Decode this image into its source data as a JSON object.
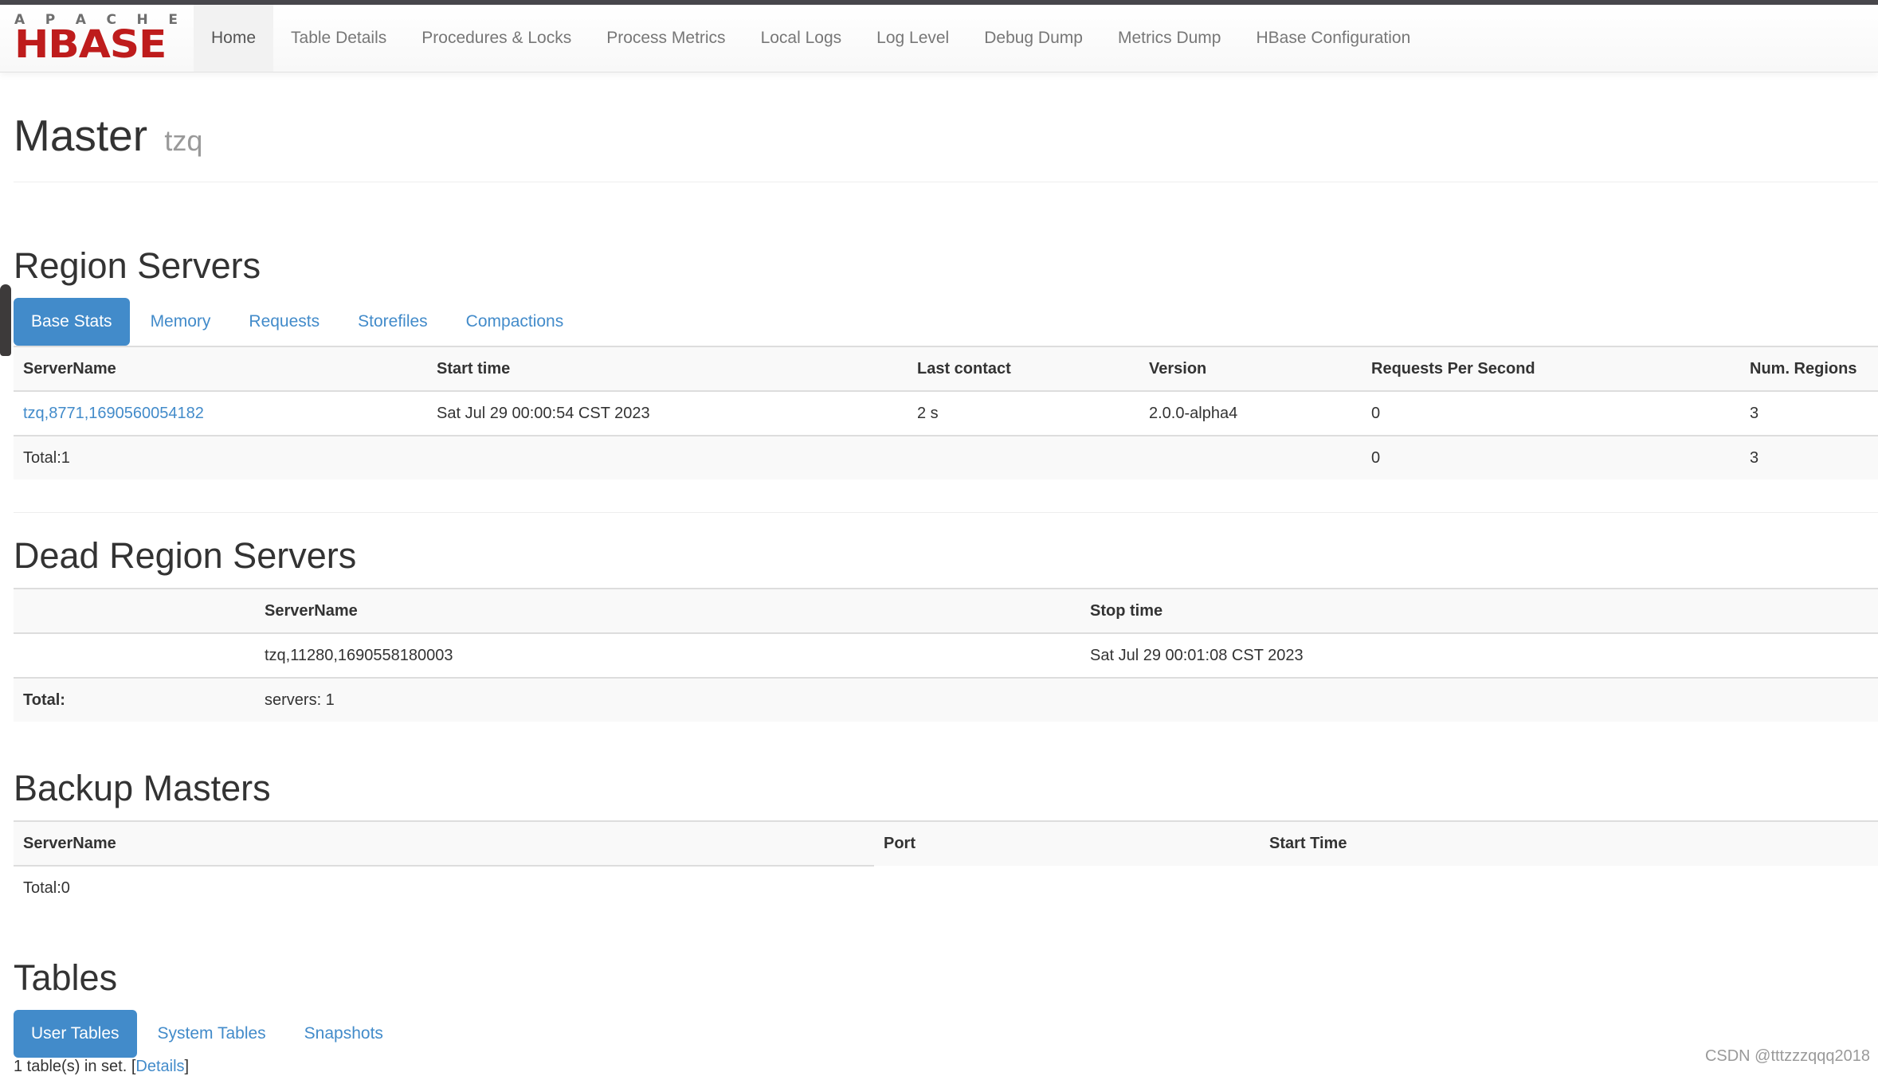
{
  "brand": {
    "top": "APACHE",
    "name": "HBASE"
  },
  "nav": {
    "items": [
      {
        "label": "Home",
        "active": true
      },
      {
        "label": "Table Details"
      },
      {
        "label": "Procedures & Locks"
      },
      {
        "label": "Process Metrics"
      },
      {
        "label": "Local Logs"
      },
      {
        "label": "Log Level"
      },
      {
        "label": "Debug Dump"
      },
      {
        "label": "Metrics Dump"
      },
      {
        "label": "HBase Configuration"
      }
    ]
  },
  "header": {
    "title": "Master",
    "subtitle": "tzq"
  },
  "region_servers": {
    "title": "Region Servers",
    "tabs": [
      "Base Stats",
      "Memory",
      "Requests",
      "Storefiles",
      "Compactions"
    ],
    "active_tab": "Base Stats",
    "columns": [
      "ServerName",
      "Start time",
      "Last contact",
      "Version",
      "Requests Per Second",
      "Num. Regions"
    ],
    "rows": [
      {
        "server_name": "tzq,8771,1690560054182",
        "start_time": "Sat Jul 29 00:00:54 CST 2023",
        "last_contact": "2 s",
        "version": "2.0.0-alpha4",
        "requests_per_second": "0",
        "num_regions": "3"
      }
    ],
    "total": {
      "label": "Total:1",
      "requests_per_second": "0",
      "num_regions": "3"
    }
  },
  "dead_region_servers": {
    "title": "Dead Region Servers",
    "columns": [
      "",
      "ServerName",
      "Stop time"
    ],
    "rows": [
      {
        "server_name": "tzq,11280,1690558180003",
        "stop_time": "Sat Jul 29 00:01:08 CST 2023"
      }
    ],
    "total": {
      "label": "Total:",
      "value": "servers: 1"
    }
  },
  "backup_masters": {
    "title": "Backup Masters",
    "columns": [
      "ServerName",
      "Port",
      "Start Time"
    ],
    "total": "Total:0"
  },
  "tables": {
    "title": "Tables",
    "tabs": [
      "User Tables",
      "System Tables",
      "Snapshots"
    ],
    "active_tab": "User Tables",
    "summary_prefix": "1 table(s) in set. [",
    "details_link": "Details",
    "summary_suffix": "]"
  },
  "watermark": "CSDN @tttzzzqqq2018"
}
